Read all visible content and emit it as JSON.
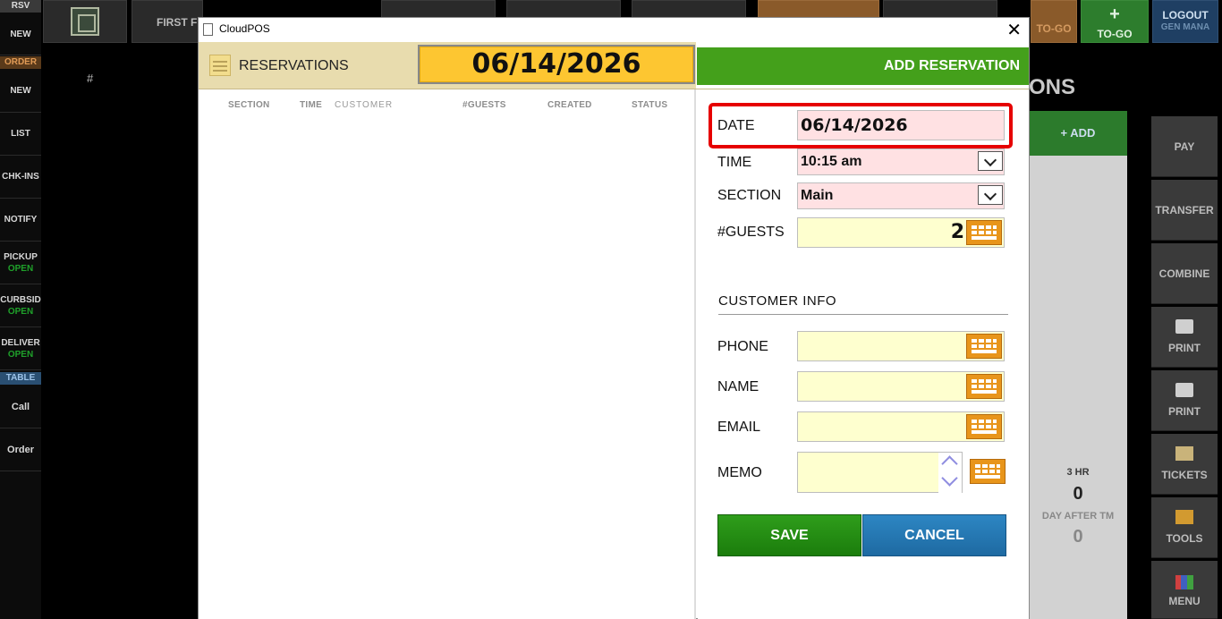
{
  "sidebar": {
    "rsv": "RSV",
    "rsv_new": "NEW",
    "order_header": "ORDER",
    "order_new": "NEW",
    "list": "LIST",
    "chk_ins": "CHK-INS",
    "notify": "NOTIFY",
    "pickup": "PICKUP",
    "pickup_status": "OPEN",
    "curbside": "CURBSID",
    "curbside_status": "OPEN",
    "delivery": "DELIVER",
    "delivery_status": "OPEN",
    "table_header": "TABLE",
    "call": "Call",
    "order": "Order"
  },
  "background": {
    "hash": "#",
    "first_floor": "FIRST F",
    "to_go_1": "TO-GO",
    "to_go_2": "TO-GO",
    "plus": "+",
    "logout": "LOGOUT",
    "logout_user": "GEN MANA",
    "ons_title": "ONS",
    "add": "+ ADD",
    "stat_3hr": "3 HR",
    "stat_3hr_value": "0",
    "stat_day_after": "DAY AFTER TM",
    "stat_day_after_value": "0",
    "right_buttons": [
      "PAY",
      "TRANSFER",
      "COMBINE",
      "PRINT",
      "PRINT",
      "TICKETS",
      "TOOLS",
      "MENU"
    ]
  },
  "window": {
    "title": "CloudPOS"
  },
  "reservations": {
    "title": "RESERVATIONS",
    "date": "06/14/2026",
    "add_button": "ADD RESERVATION",
    "columns": [
      "SECTION",
      "TIME",
      "CUSTOMER",
      "#GUESTS",
      "CREATED",
      "STATUS"
    ]
  },
  "form": {
    "date_label": "DATE",
    "date_value": "06/14/2026",
    "time_label": "TIME",
    "time_value": "10:15 am",
    "section_label": "SECTION",
    "section_value": "Main",
    "guests_label": "#GUESTS",
    "guests_value": "2",
    "customer_info": "CUSTOMER INFO",
    "phone_label": "PHONE",
    "phone_value": "",
    "name_label": "NAME",
    "name_value": "",
    "email_label": "EMAIL",
    "email_value": "",
    "memo_label": "MEMO",
    "memo_value": "",
    "save": "SAVE",
    "cancel": "CANCEL"
  },
  "colors": {
    "accent_green": "#44a01b",
    "date_yellow": "#fdc631",
    "highlight_red": "#e60000",
    "keyboard_orange": "#e8951b"
  }
}
